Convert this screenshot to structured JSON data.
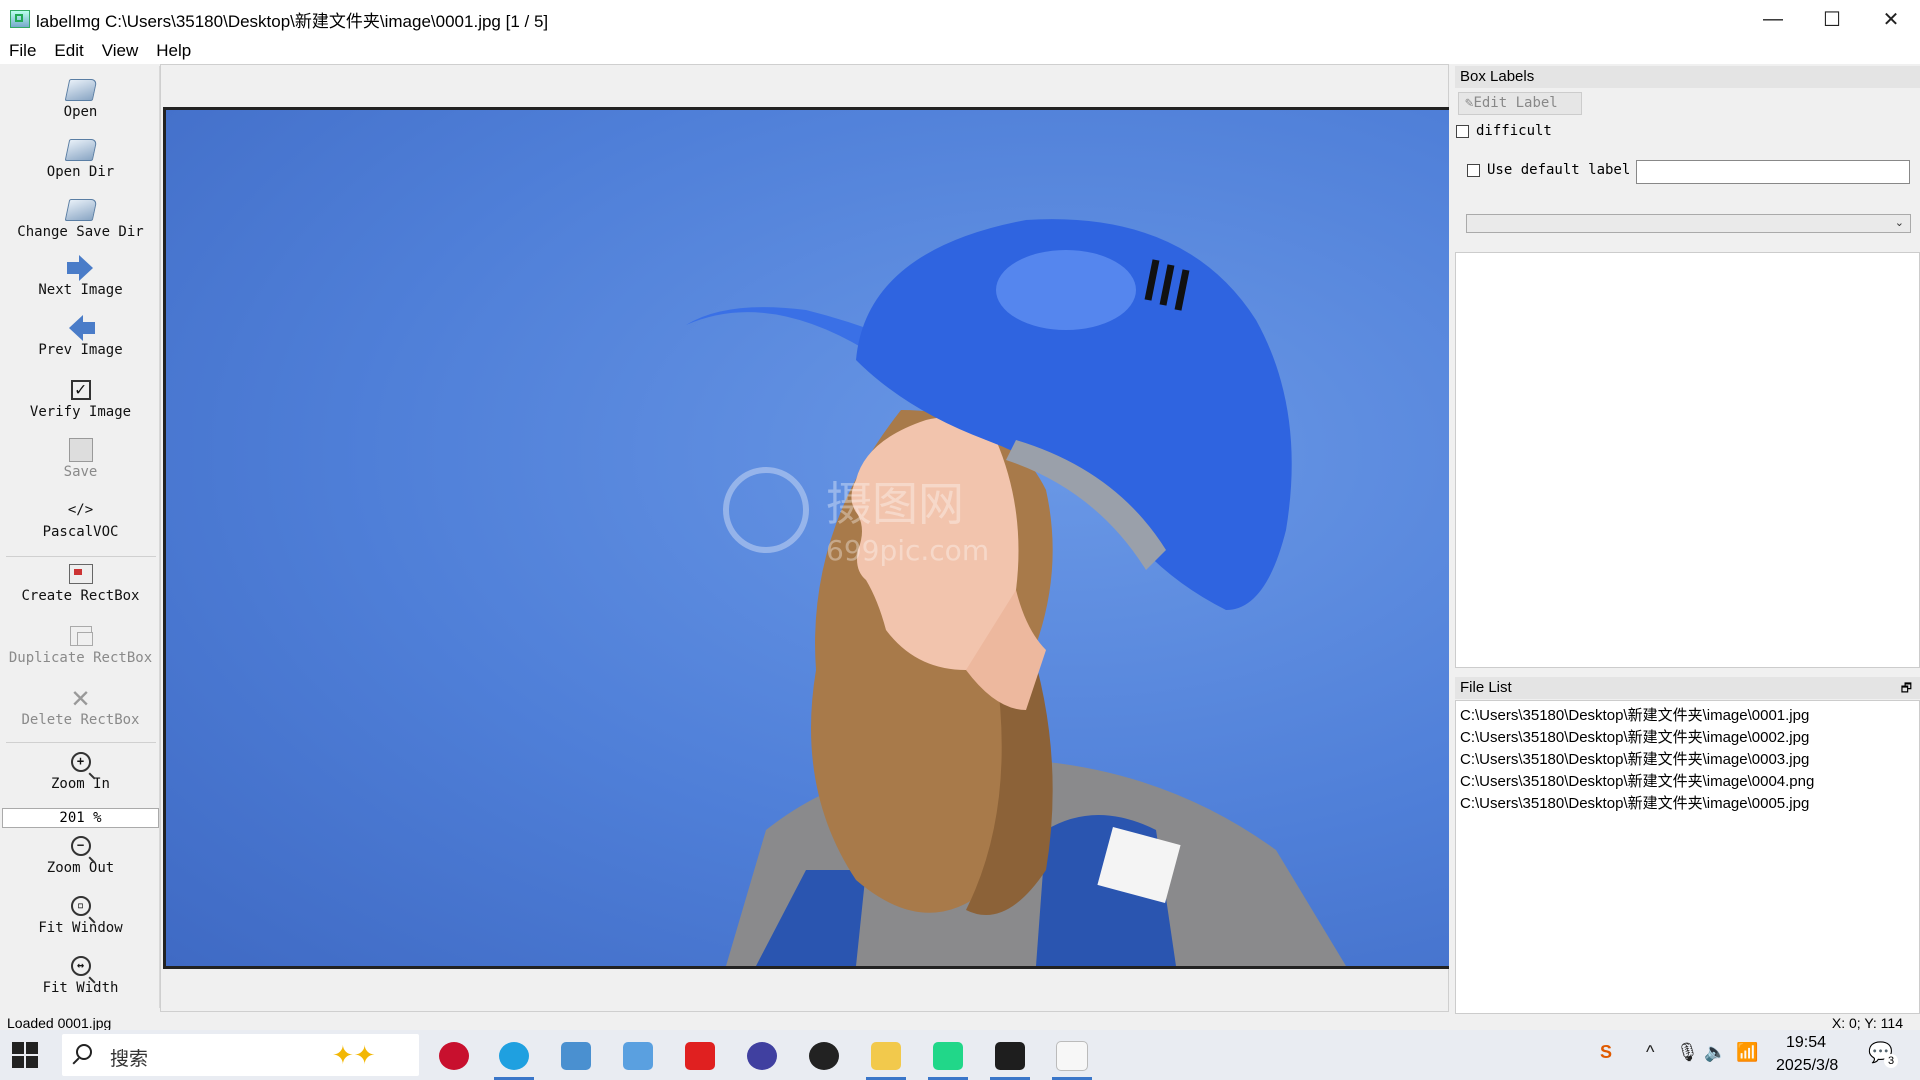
{
  "window": {
    "title": "labelImg C:\\Users\\35180\\Desktop\\新建文件夹\\image\\0001.jpg [1 / 5]",
    "minimize_glyph": "—",
    "maximize_glyph": "☐",
    "close_glyph": "✕"
  },
  "menu": [
    "File",
    "Edit",
    "View",
    "Help"
  ],
  "toolbar": {
    "open": "Open",
    "open_dir": "Open Dir",
    "change_save_dir": "Change Save Dir",
    "next_image": "Next Image",
    "prev_image": "Prev Image",
    "verify_image": "Verify Image",
    "save": "Save",
    "format_glyph": "</>",
    "format": "PascalVOC",
    "create_rectbox": "Create RectBox",
    "duplicate_rectbox": "Duplicate RectBox",
    "delete_rectbox": "Delete RectBox",
    "zoom_in": "Zoom In",
    "zoom_value": "201 %",
    "zoom_out": "Zoom Out",
    "fit_window": "Fit Window",
    "fit_width": "Fit Width"
  },
  "canvas": {
    "watermark_cn": "摄图网",
    "watermark_en": "699pic.com"
  },
  "box_labels": {
    "title": "Box Labels",
    "edit_label": "Edit Label",
    "difficult": "difficult",
    "use_default_label": "Use default label",
    "default_label_value": "",
    "combo_value": ""
  },
  "file_list": {
    "title": "File List",
    "files": [
      "C:\\Users\\35180\\Desktop\\新建文件夹\\image\\0001.jpg",
      "C:\\Users\\35180\\Desktop\\新建文件夹\\image\\0002.jpg",
      "C:\\Users\\35180\\Desktop\\新建文件夹\\image\\0003.jpg",
      "C:\\Users\\35180\\Desktop\\新建文件夹\\image\\0004.png",
      "C:\\Users\\35180\\Desktop\\新建文件夹\\image\\0005.jpg"
    ]
  },
  "status": {
    "left": "Loaded 0001.jpg",
    "right": "X: 0; Y: 114"
  },
  "taskbar": {
    "search_placeholder": "搜索",
    "ime_badge": "S",
    "time": "19:54",
    "date": "2025/3/8",
    "notification_count": "3",
    "app_colors": {
      "record": "#c8102e",
      "edge": "#1fa0e0",
      "control_panel": "#4a90d0",
      "desktop": "#5aa0e0",
      "wps": "#e02020",
      "dict": "#4040a0",
      "obs": "#222222",
      "explorer": "#f2c94c",
      "pycharm": "#21d789",
      "terminal": "#1e1e1e",
      "notepad": "#f7f7f7"
    }
  },
  "colors": {
    "photo_background": "#4f7fd8",
    "helmet": "#2f64e0",
    "accent": "#3a76c9"
  }
}
